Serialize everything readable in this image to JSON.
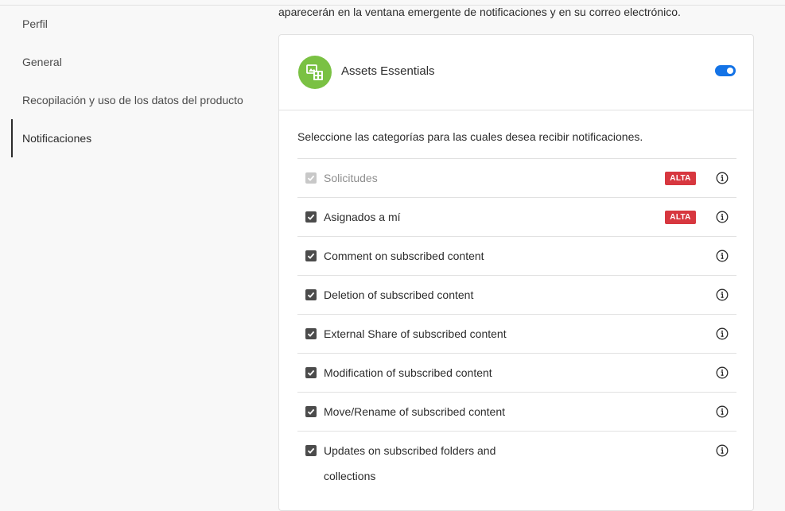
{
  "sidebar": {
    "items": [
      {
        "label": "Perfil",
        "active": false
      },
      {
        "label": "General",
        "active": false
      },
      {
        "label": "Recopilación y uso de los datos del producto",
        "active": false
      },
      {
        "label": "Notificaciones",
        "active": true
      }
    ]
  },
  "main": {
    "intro_text": "aparecerán en la ventana emergente de notificaciones y en su correo electrónico.",
    "product": {
      "name": "Assets Essentials",
      "enabled": true,
      "logo_color": "#7ac143",
      "icon": "assets-essentials-logo-icon"
    },
    "instructions": "Seleccione las categorías para las cuales desea recibir notificaciones.",
    "categories": [
      {
        "label": "Solicitudes",
        "checked": true,
        "disabled": true,
        "badge": "ALTA"
      },
      {
        "label": "Asignados a mí",
        "checked": true,
        "disabled": false,
        "badge": "ALTA"
      },
      {
        "label": "Comment on subscribed content",
        "checked": true,
        "disabled": false
      },
      {
        "label": "Deletion of subscribed content",
        "checked": true,
        "disabled": false
      },
      {
        "label": "External Share of subscribed content",
        "checked": true,
        "disabled": false
      },
      {
        "label": "Modification of subscribed content",
        "checked": true,
        "disabled": false
      },
      {
        "label": "Move/Rename of subscribed content",
        "checked": true,
        "disabled": false
      },
      {
        "label": "Updates on subscribed folders and collections",
        "checked": true,
        "disabled": false
      }
    ]
  },
  "colors": {
    "accent": "#1473e6",
    "badge": "#d7373f",
    "checkbox": "#4b4b4b",
    "checkbox_disabled": "#c8c8c8"
  }
}
